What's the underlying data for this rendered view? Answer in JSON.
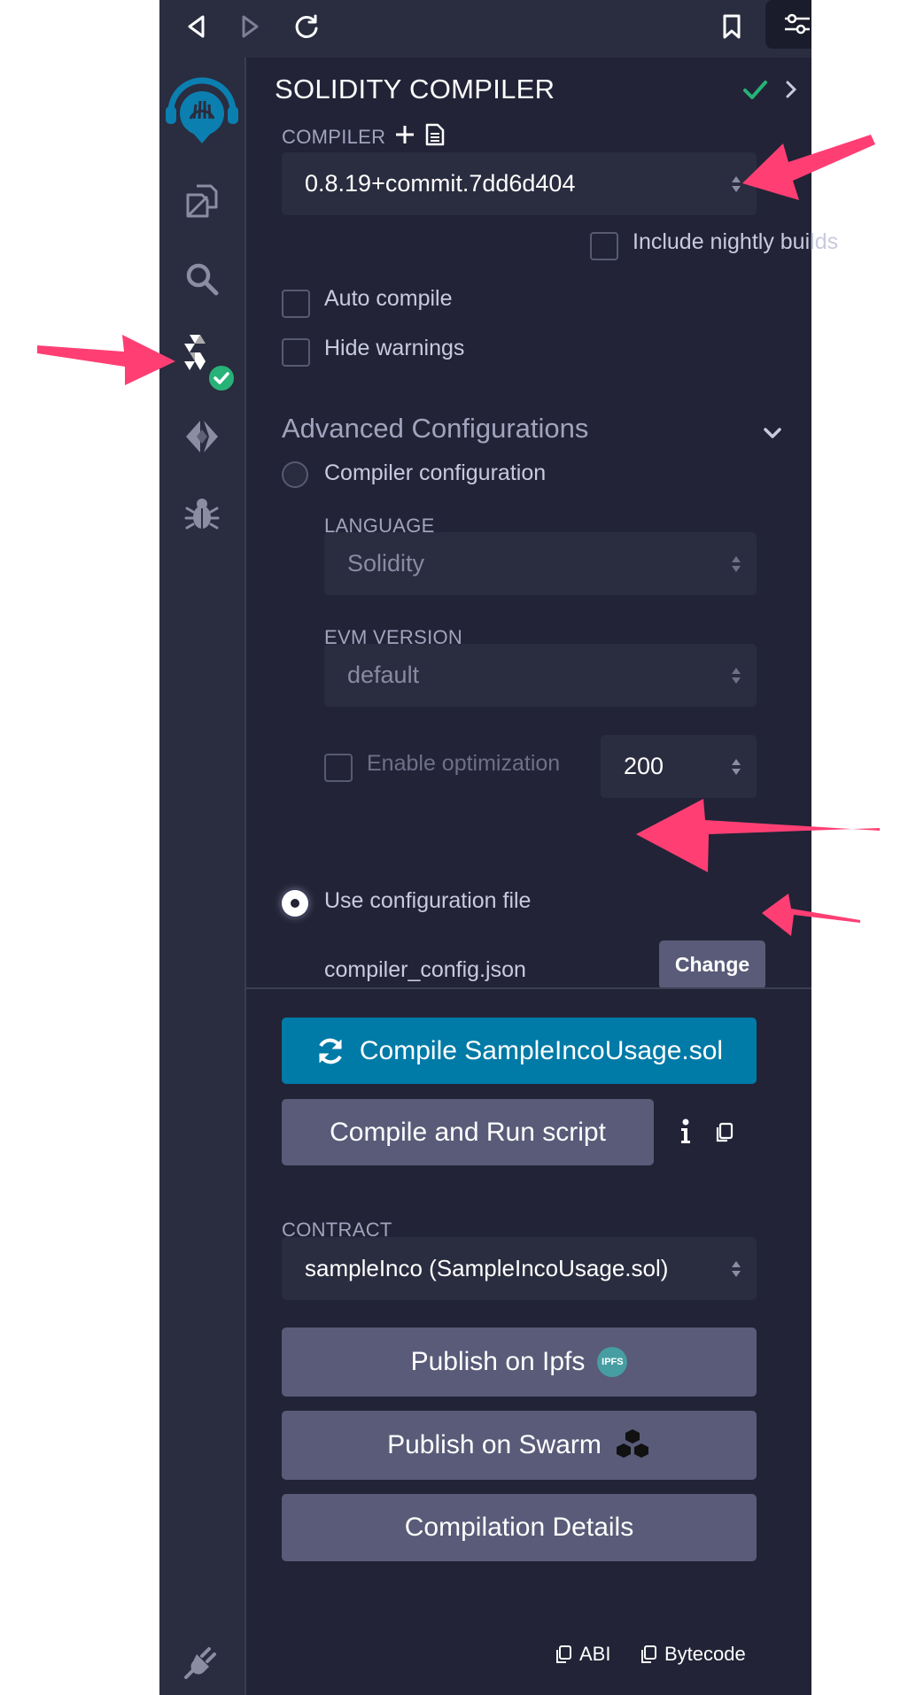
{
  "panel": {
    "title": "SOLIDITY COMPILER",
    "compiler_label": "COMPILER",
    "compiler_version": "0.8.19+commit.7dd6d404",
    "include_nightly": "Include nightly builds",
    "auto_compile": "Auto compile",
    "hide_warnings": "Hide warnings",
    "advanced_title": "Advanced Configurations",
    "compiler_configuration": "Compiler configuration",
    "language_label": "LANGUAGE",
    "language_value": "Solidity",
    "evm_label": "EVM VERSION",
    "evm_value": "default",
    "enable_optimization": "Enable optimization",
    "runs_value": "200",
    "use_config_file": "Use configuration file",
    "config_filename": "compiler_config.json",
    "change_button": "Change",
    "compile_button": "Compile SampleIncoUsage.sol",
    "compile_run_button": "Compile and Run script",
    "contract_label": "CONTRACT",
    "contract_value": "sampleInco (SampleIncoUsage.sol)",
    "publish_ipfs": "Publish on Ipfs",
    "ipfs_badge": "IPFS",
    "publish_swarm": "Publish on Swarm",
    "compilation_details": "Compilation Details",
    "abi_link": "ABI",
    "bytecode_link": "Bytecode"
  },
  "icons": [
    "back-icon",
    "forward-icon",
    "reload-icon",
    "bookmark-icon",
    "settings-sliders-icon",
    "remix-logo-icon",
    "file-explorer-icon",
    "search-icon",
    "solidity-compiler-icon",
    "success-check-icon",
    "deploy-run-icon",
    "debugger-icon",
    "plugin-manager-icon",
    "plus-icon",
    "document-icon",
    "chevron-right-icon",
    "chevron-down-icon",
    "sync-icon",
    "info-icon",
    "copy-icon"
  ],
  "colors": {
    "background": "#222336",
    "sidebar": "#2a2c3f",
    "accent": "#007aa6",
    "button": "#595b78",
    "success": "#27b278",
    "annotation_arrow": "#ff3f74"
  }
}
